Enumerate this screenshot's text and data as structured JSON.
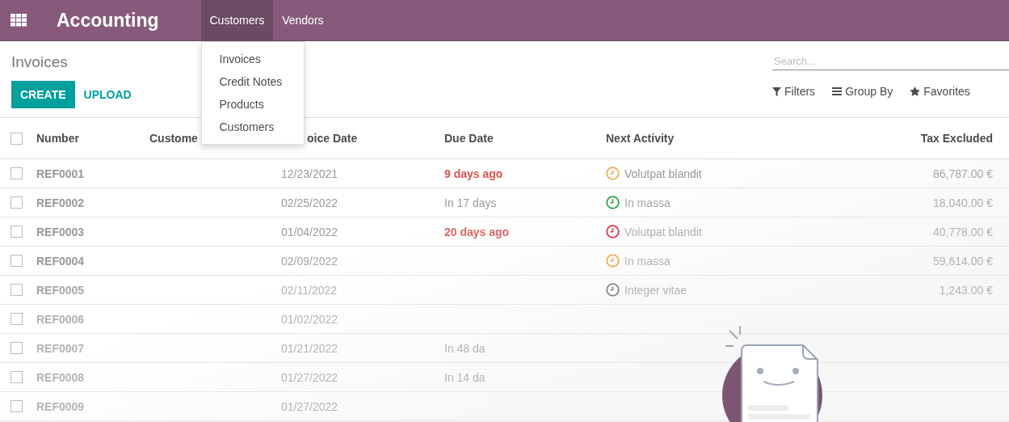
{
  "navbar": {
    "app_title": "Accounting",
    "menus": [
      {
        "label": "Customers",
        "selected": true
      },
      {
        "label": "Vendors",
        "selected": false
      }
    ]
  },
  "dropdown": {
    "items": [
      "Invoices",
      "Credit Notes",
      "Products",
      "Customers"
    ]
  },
  "control_panel": {
    "title": "Invoices",
    "buttons": [
      {
        "label": "CREATE",
        "kind": "primary"
      },
      {
        "label": "UPLOAD",
        "kind": "link"
      }
    ],
    "search": {
      "placeholder": "Search..."
    },
    "filters": [
      {
        "label": "Filters",
        "kind": "filter"
      },
      {
        "label": "Group By",
        "kind": "group"
      },
      {
        "label": "Favorites",
        "kind": "star"
      }
    ]
  },
  "table": {
    "select_all_checked": false,
    "columns": [
      "Number",
      "Custome",
      "oice Date",
      "Due Date",
      "Next Activity",
      "Tax Excluded"
    ],
    "rows": [
      {
        "checked": false,
        "number": "REF0001",
        "invoice_date": "12/23/2021",
        "due_date": "9 days ago",
        "overdue": true,
        "activity": "Volutpat blandit",
        "color": "#f0ad4e",
        "amount": "86,787.00 €"
      },
      {
        "checked": false,
        "number": "REF0002",
        "invoice_date": "02/25/2022",
        "due_date": "In 17 days",
        "overdue": false,
        "activity": "In massa",
        "color": "#28a745",
        "amount": "18,040.00 €"
      },
      {
        "checked": false,
        "number": "REF0003",
        "invoice_date": "01/04/2022",
        "due_date": "20 days ago",
        "overdue": true,
        "activity": "Volutpat blandit",
        "color": "#dc3545",
        "amount": "40,778.00 €"
      },
      {
        "checked": false,
        "number": "REF0004",
        "invoice_date": "02/09/2022",
        "activity": "In massa",
        "color": "#f0ad4e",
        "amount": "59,614.00 €"
      },
      {
        "checked": false,
        "number": "REF0005",
        "invoice_date": "02/11/2022",
        "activity": "Integer vitae",
        "color": "#888888",
        "amount": "1,243.00 €"
      },
      {
        "checked": false,
        "number": "REF0006",
        "invoice_date": "01/02/2022"
      },
      {
        "checked": false,
        "number": "REF0007",
        "invoice_date": "01/21/2022",
        "due_date": "In 48 da",
        "overdue": false
      },
      {
        "checked": false,
        "number": "REF0008",
        "invoice_date": "01/27/2022",
        "due_date": "In 14 da",
        "overdue": false
      },
      {
        "checked": false,
        "number": "REF0009",
        "invoice_date": "01/27/2022"
      }
    ]
  }
}
